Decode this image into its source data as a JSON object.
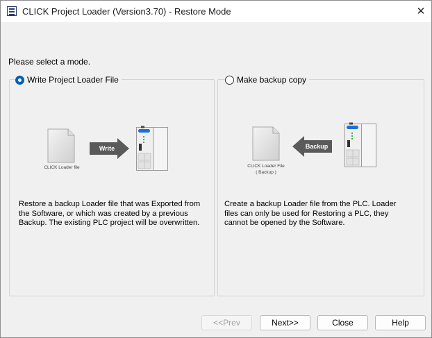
{
  "window": {
    "title": "CLICK Project Loader (Version3.70) - Restore Mode",
    "close_glyph": "✕"
  },
  "prompt": "Please select a mode.",
  "modes": [
    {
      "label": "Write Project Loader File",
      "selected": true,
      "file_caption": "CLICK Loader file",
      "arrow_label": "Write",
      "description": [
        "Restore a backup Loader file that was Exported from",
        "the Software, or which was created by a previous",
        "Backup. The existing PLC project will be overwritten."
      ]
    },
    {
      "label": "Make backup copy",
      "selected": false,
      "file_caption_line1": "CLICK Loader File",
      "file_caption_line2": "( Backup )",
      "arrow_label": "Backup",
      "description": [
        "Create a backup Loader file from the PLC. Loader",
        "files can only be used for Restoring a PLC, they",
        "cannot be opened by the Software."
      ]
    }
  ],
  "buttons": {
    "prev": "<<Prev",
    "next": "Next>>",
    "close": "Close",
    "help": "Help"
  },
  "colors": {
    "accent": "#005fb8",
    "arrow": "#5a5a5a",
    "plc_led_blue": "#1f6fd6",
    "plc_led_green": "#3cb043"
  }
}
